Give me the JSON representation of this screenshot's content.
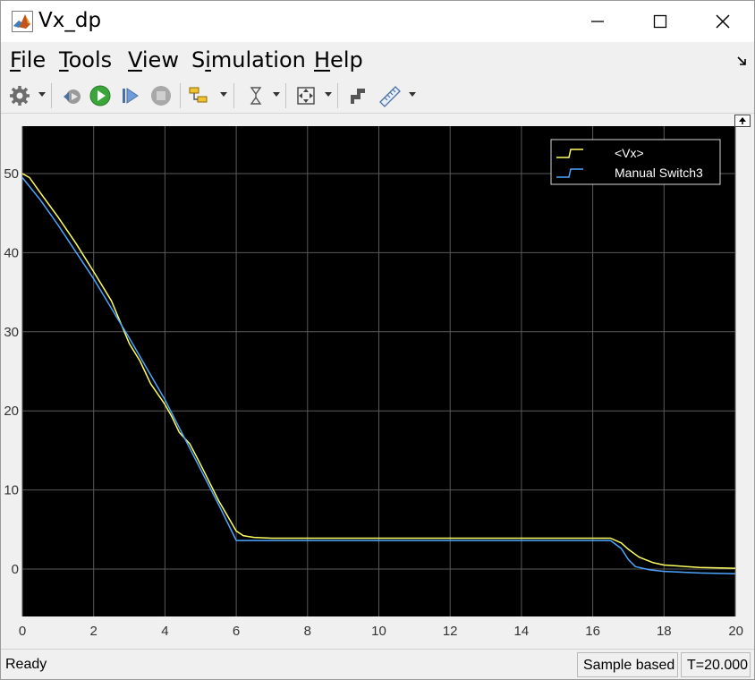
{
  "window": {
    "title": "Vx_dp"
  },
  "menu": {
    "file": {
      "accel": "F",
      "rest": "ile"
    },
    "tools": {
      "accel": "T",
      "rest": "ools"
    },
    "view": {
      "accel": "V",
      "rest": "iew"
    },
    "simulation": {
      "pre": "S",
      "accel": "i",
      "rest": "mulation"
    },
    "help": {
      "accel": "H",
      "rest": "elp"
    }
  },
  "toolbar": {
    "icons": [
      "gear-icon",
      "step-back-icon",
      "run-icon",
      "step-forward-icon",
      "stop-icon",
      "highlight-block-icon",
      "trigger-icon",
      "zoom-fit-icon",
      "style-icon",
      "measure-icon"
    ]
  },
  "chart_data": {
    "type": "line",
    "title": "",
    "xlabel": "",
    "ylabel": "",
    "xlim": [
      0,
      20
    ],
    "ylim": [
      -6,
      56
    ],
    "xticks": [
      "0",
      "2",
      "4",
      "6",
      "8",
      "10",
      "12",
      "14",
      "16",
      "18",
      "20"
    ],
    "yticks": [
      "0",
      "10",
      "20",
      "30",
      "40",
      "50"
    ],
    "grid": true,
    "background": "#000000",
    "legend_position": "top-right",
    "series": [
      {
        "name": "<Vx>",
        "color": "#ffff5f",
        "points": [
          [
            0,
            50
          ],
          [
            0.2,
            49.5
          ],
          [
            0.5,
            47.6
          ],
          [
            1,
            44.5
          ],
          [
            1.5,
            41.2
          ],
          [
            2,
            37.6
          ],
          [
            2.5,
            33.9
          ],
          [
            3,
            28.5
          ],
          [
            3.3,
            26.3
          ],
          [
            3.6,
            23.4
          ],
          [
            4,
            20.8
          ],
          [
            4.2,
            19.2
          ],
          [
            4.4,
            17.3
          ],
          [
            4.7,
            15.8
          ],
          [
            5,
            13.2
          ],
          [
            5.5,
            8.7
          ],
          [
            6,
            4.8
          ],
          [
            6.2,
            4.2
          ],
          [
            6.5,
            4.0
          ],
          [
            7,
            3.9
          ],
          [
            10,
            3.9
          ],
          [
            14,
            3.9
          ],
          [
            16,
            3.9
          ],
          [
            16.5,
            3.9
          ],
          [
            16.8,
            3.3
          ],
          [
            17,
            2.5
          ],
          [
            17.3,
            1.5
          ],
          [
            17.7,
            0.8
          ],
          [
            18,
            0.5
          ],
          [
            19,
            0.2
          ],
          [
            20,
            0.1
          ]
        ]
      },
      {
        "name": "Manual Switch3",
        "color": "#4da6ff",
        "points": [
          [
            0,
            49.5
          ],
          [
            0.5,
            46.7
          ],
          [
            1,
            43.5
          ],
          [
            2,
            36.7
          ],
          [
            3,
            29.2
          ],
          [
            4,
            21.4
          ],
          [
            4.5,
            17.0
          ],
          [
            5,
            12.6
          ],
          [
            5.5,
            8.2
          ],
          [
            6,
            3.6
          ],
          [
            6.1,
            3.6
          ],
          [
            10,
            3.6
          ],
          [
            14,
            3.6
          ],
          [
            16,
            3.6
          ],
          [
            16.5,
            3.6
          ],
          [
            16.8,
            2.6
          ],
          [
            17,
            1.2
          ],
          [
            17.2,
            0.3
          ],
          [
            17.6,
            -0.1
          ],
          [
            18,
            -0.3
          ],
          [
            19,
            -0.5
          ],
          [
            20,
            -0.6
          ]
        ]
      }
    ]
  },
  "status": {
    "ready": "Ready",
    "mode": "Sample based",
    "time": "T=20.000"
  }
}
